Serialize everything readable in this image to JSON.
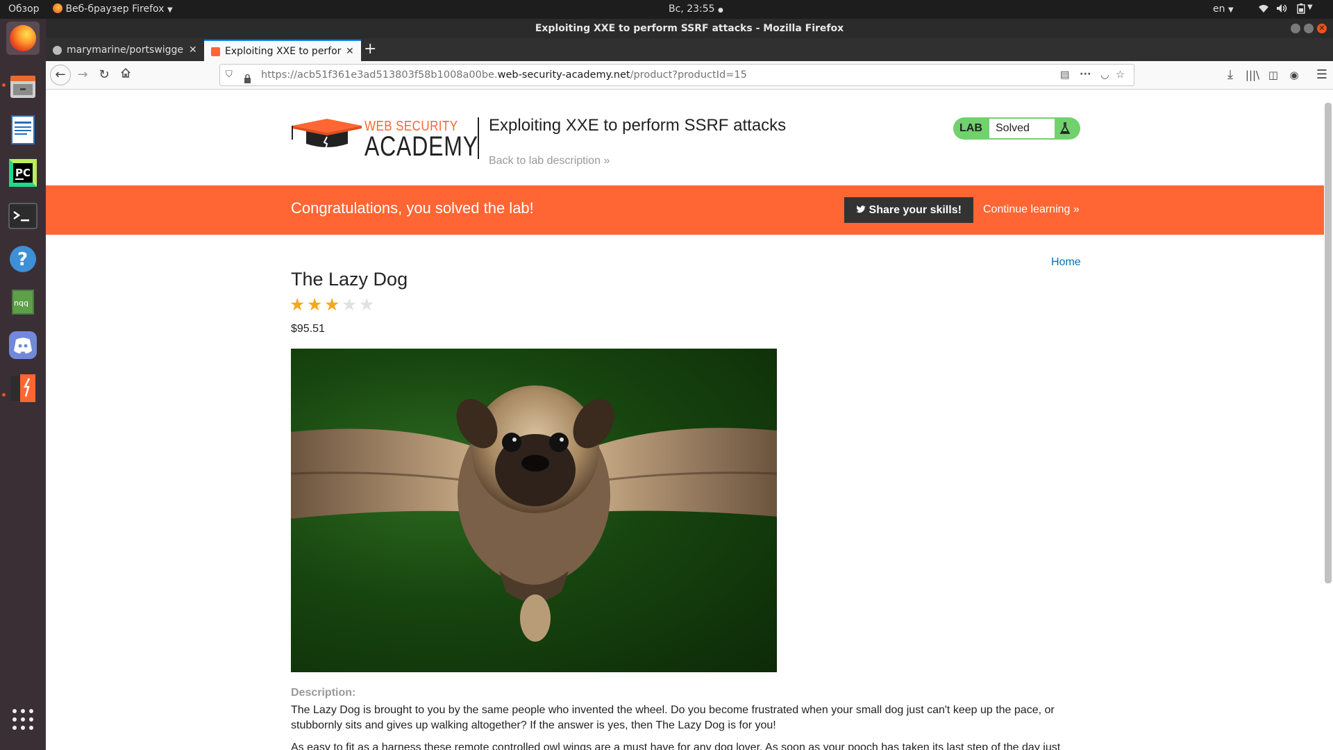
{
  "system_bar": {
    "overview": "Обзор",
    "app_menu": "Веб-браузер Firefox",
    "clock": "Вс, 23:55",
    "lang": "en"
  },
  "window": {
    "title": "Exploiting XXE to perform SSRF attacks - Mozilla Firefox"
  },
  "tabs": [
    {
      "label": "marymarine/portswigge"
    },
    {
      "label": "Exploiting XXE to perfor"
    }
  ],
  "url": {
    "prefix": "https://acb51f361e3ad513803f58b1008a00be.",
    "domain": "web-security-academy.net",
    "path": "/product?productId=15"
  },
  "header": {
    "logo_top": "WEB SECURITY",
    "logo_bottom": "ACADEMY",
    "lab_title": "Exploiting XXE to perform SSRF attacks",
    "back_link": "Back to lab description",
    "lab_badge": "LAB",
    "lab_status": "Solved"
  },
  "banner": {
    "message": "Congratulations, you solved the lab!",
    "share_button": "Share your skills!",
    "continue_link": "Continue learning"
  },
  "product": {
    "home_link": "Home",
    "title": "The Lazy Dog",
    "rating": 3,
    "rating_max": 5,
    "price": "$95.51",
    "description_label": "Description:",
    "description_p1": "The Lazy Dog is brought to you by the same people who invented the wheel. Do you become frustrated when your small dog just can't keep up the pace, or stubbornly sits and gives up walking altogether? If the answer is yes, then The Lazy Dog is for you!",
    "description_p2": "As easy to fit as a harness these remote controlled owl wings are a must have for any dog lover. As soon as your pooch has taken its last step of the day just"
  },
  "colors": {
    "brand_orange": "#ff6633",
    "solved_green": "#70d16d",
    "link_blue": "#0071bc",
    "star_gold": "#f4a81d"
  }
}
